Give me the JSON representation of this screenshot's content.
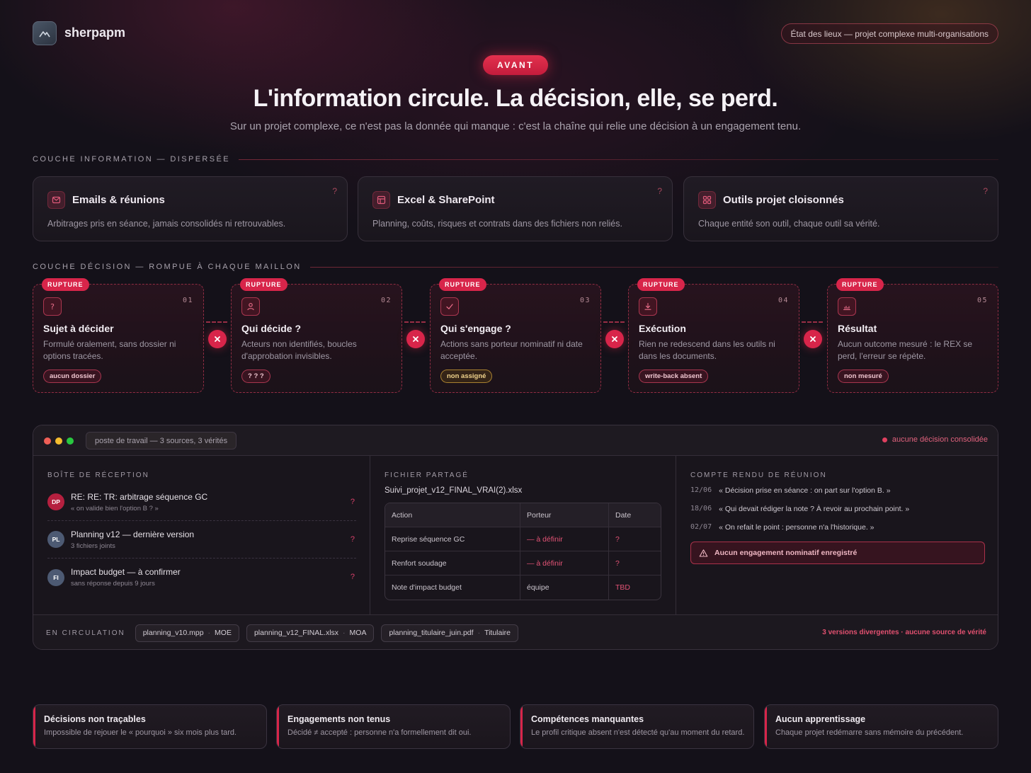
{
  "brand": {
    "name": "sherpapm",
    "pill": "État des lieux — projet complexe multi-organisations"
  },
  "hero": {
    "badge": "AVANT",
    "title": "L'information circule. La décision, elle, se perd.",
    "subtitle": "Sur un projet complexe, ce n'est pas la donnée qui manque : c'est la chaîne qui relie une décision à un engagement tenu."
  },
  "info_layer": {
    "label": "COUCHE INFORMATION — DISPERSÉE",
    "cards": [
      {
        "title": "Emails & réunions",
        "desc": "Arbitrages pris en séance, jamais consolidés ni retrouvables.",
        "icon": "mail-icon",
        "mark": "?"
      },
      {
        "title": "Excel & SharePoint",
        "desc": "Planning, coûts, risques et contrats dans des fichiers non reliés.",
        "icon": "spreadsheet-icon",
        "mark": "?"
      },
      {
        "title": "Outils projet cloisonnés",
        "desc": "Chaque entité son outil, chaque outil sa vérité.",
        "icon": "grid-icon",
        "mark": "?"
      }
    ]
  },
  "decision_layer": {
    "label": "COUCHE DÉCISION — ROMPUE À CHAQUE MAILLON",
    "badge": "RUPTURE",
    "steps": [
      {
        "num": "01",
        "title": "Sujet à décider",
        "desc": "Formulé oralement, sans dossier ni options tracées.",
        "tag": "aucun dossier",
        "icon": "question-icon"
      },
      {
        "num": "02",
        "title": "Qui décide ?",
        "desc": "Acteurs non identifiés, boucles d'approbation invisibles.",
        "tag": "? ? ?",
        "icon": "user-icon"
      },
      {
        "num": "03",
        "title": "Qui s'engage ?",
        "desc": "Actions sans porteur nominatif ni date acceptée.",
        "tag": "non assigné",
        "icon": "check-icon"
      },
      {
        "num": "04",
        "title": "Exécution",
        "desc": "Rien ne redescend dans les outils ni dans les documents.",
        "tag": "write-back absent",
        "icon": "download-icon"
      },
      {
        "num": "05",
        "title": "Résultat",
        "desc": "Aucun outcome mesuré : le REX se perd, l'erreur se répète.",
        "tag": "non mesuré",
        "icon": "chart-icon"
      }
    ]
  },
  "workspace": {
    "title": "poste de travail — 3 sources, 3 vérités",
    "status": "aucune décision consolidée",
    "inbox": {
      "label": "BOÎTE DE RÉCEPTION",
      "mails": [
        {
          "initials": "DP",
          "subject": "RE: RE: TR: arbitrage séquence GC",
          "sub": "« on valide bien l'option B ? »",
          "mark": "?",
          "color": "#b5203f"
        },
        {
          "initials": "PL",
          "subject": "Planning v12 — dernière version",
          "sub": "3 fichiers joints",
          "mark": "?",
          "color": "#4d5a73"
        },
        {
          "initials": "FI",
          "subject": "Impact budget — à confirmer",
          "sub": "sans réponse depuis 9 jours",
          "mark": "?",
          "color": "#4d5a73"
        }
      ]
    },
    "shared_file": {
      "label": "FICHIER PARTAGÉ",
      "filename": "Suivi_projet_v12_FINAL_VRAI(2).xlsx",
      "headers": [
        "Action",
        "Porteur",
        "Date"
      ],
      "rows": [
        [
          "Reprise séquence GC",
          "— à définir",
          "?"
        ],
        [
          "Renfort soudage",
          "— à définir",
          "?"
        ],
        [
          "Note d'impact budget",
          "équipe",
          "TBD"
        ]
      ]
    },
    "minutes": {
      "label": "COMPTE RENDU DE RÉUNION",
      "lines": [
        {
          "date": "12/06",
          "text": "« Décision prise en séance : on part sur l'option B. »"
        },
        {
          "date": "18/06",
          "text": "« Qui devait rédiger la note ? À revoir au prochain point. »"
        },
        {
          "date": "02/07",
          "text": "« On refait le point : personne n'a l'historique. »"
        }
      ],
      "alert": "Aucun engagement nominatif enregistré"
    },
    "footer": {
      "label": "EN CIRCULATION",
      "files": [
        {
          "name": "planning_v10.mpp",
          "org": "MOE"
        },
        {
          "name": "planning_v12_FINAL.xlsx",
          "org": "MOA"
        },
        {
          "name": "planning_titulaire_juin.pdf",
          "org": "Titulaire"
        }
      ],
      "separator": "·",
      "warning": "3 versions divergentes · aucune source de vérité"
    }
  },
  "consequences": [
    {
      "title": "Décisions non traçables",
      "desc": "Impossible de rejouer le « pourquoi » six mois plus tard."
    },
    {
      "title": "Engagements non tenus",
      "desc": "Décidé ≠ accepté : personne n'a formellement dit oui."
    },
    {
      "title": "Compétences manquantes",
      "desc": "Le profil critique absent n'est détecté qu'au moment du retard."
    },
    {
      "title": "Aucun apprentissage",
      "desc": "Chaque projet redémarre sans mémoire du précédent."
    }
  ],
  "colors": {
    "accent": "#d8254a",
    "background": "#141119",
    "warning": "#f1d38c"
  }
}
